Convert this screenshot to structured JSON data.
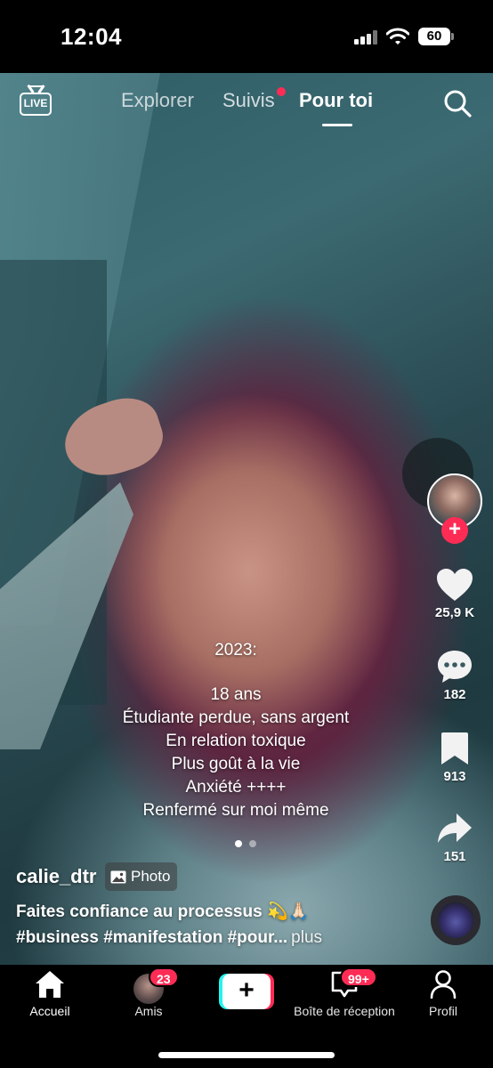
{
  "status_bar": {
    "time": "12:04",
    "battery": "60"
  },
  "top_nav": {
    "live_label": "LIVE",
    "tabs": [
      {
        "label": "Explorer"
      },
      {
        "label": "Suivis"
      },
      {
        "label": "Pour toi"
      }
    ]
  },
  "overlay": {
    "year": "2023:",
    "lines": [
      "18 ans",
      "Étudiante perdue, sans argent",
      "En relation toxique",
      "Plus goût à la vie",
      "Anxiété ++++",
      "Renfermé sur moi même"
    ]
  },
  "rail": {
    "follow_symbol": "+",
    "likes": "25,9 K",
    "comments": "182",
    "saves": "913",
    "shares": "151"
  },
  "post": {
    "username": "calie_dtr",
    "badge_label": "Photo",
    "caption": "Faites confiance au processus 💫🙏🏻",
    "hashtags": "#business #manifestation #pour...",
    "more": "plus"
  },
  "bottom_nav": {
    "home": "Accueil",
    "friends": "Amis",
    "friends_badge": "23",
    "create_symbol": "+",
    "inbox": "Boîte de réception",
    "inbox_badge": "99+",
    "profile": "Profil"
  },
  "colors": {
    "accent": "#fe2c55",
    "cyan": "#25f4ee"
  }
}
